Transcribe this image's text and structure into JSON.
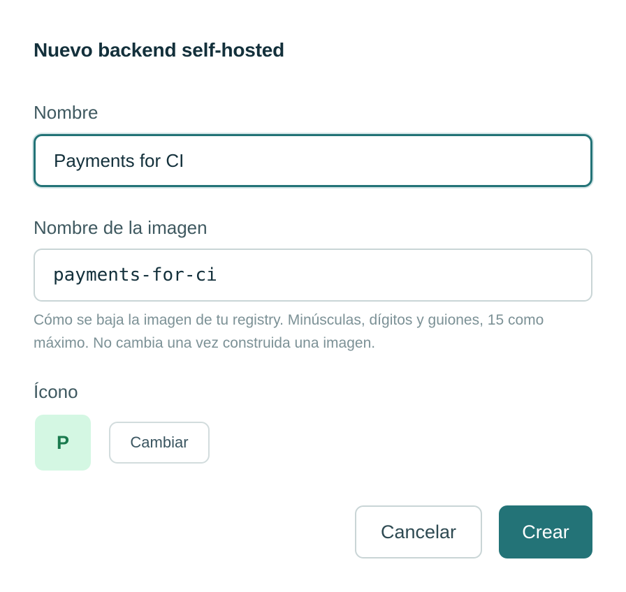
{
  "dialog": {
    "title": "Nuevo backend self-hosted"
  },
  "fields": {
    "name_label": "Nombre",
    "name_value": "Payments for CI",
    "image_label": "Nombre de la imagen",
    "image_value": "payments-for-ci",
    "image_hint": "Cómo se baja la imagen de tu registry. Minúsculas, dígitos y guiones, 15 como máximo. No cambia una vez construida una imagen."
  },
  "icon": {
    "label": "Ícono",
    "letter": "P",
    "change_label": "Cambiar",
    "background_color": "#d4f7e3",
    "letter_color": "#1a7a4e"
  },
  "actions": {
    "cancel_label": "Cancelar",
    "create_label": "Crear"
  },
  "colors": {
    "accent": "#237377",
    "text_primary": "#13303b",
    "hint": "#7c9196"
  }
}
